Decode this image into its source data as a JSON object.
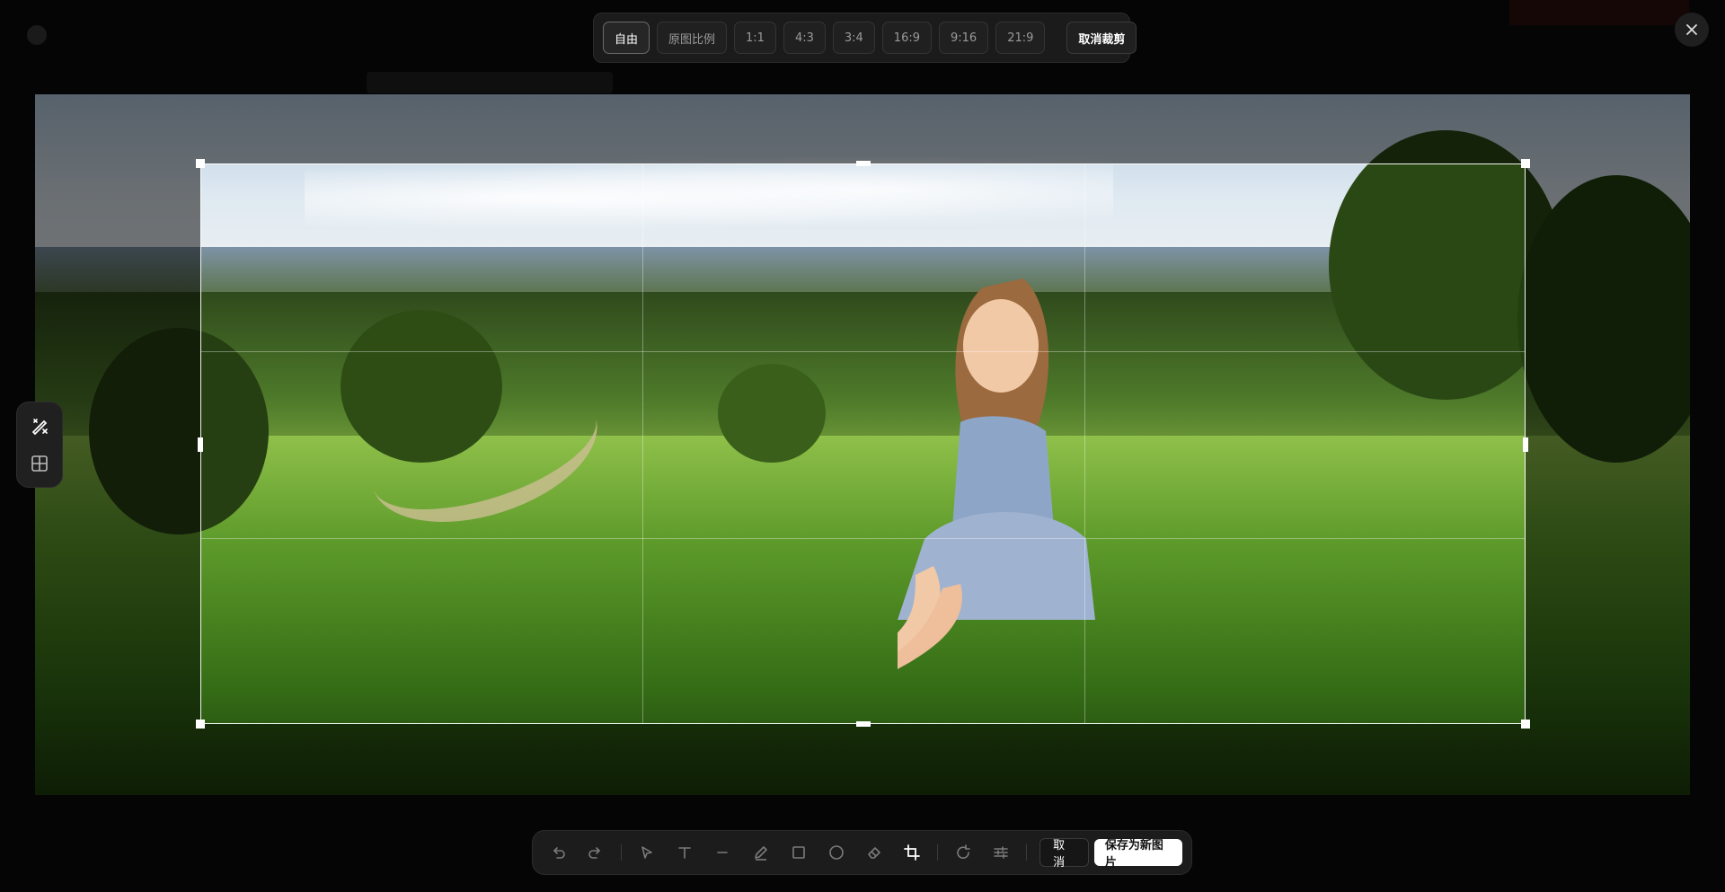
{
  "ratio_toolbar": {
    "options": [
      {
        "label": "自由",
        "active": true
      },
      {
        "label": "原图比例",
        "active": false
      },
      {
        "label": "1:1",
        "active": false
      },
      {
        "label": "4:3",
        "active": false
      },
      {
        "label": "3:4",
        "active": false
      },
      {
        "label": "16:9",
        "active": false
      },
      {
        "label": "9:16",
        "active": false
      },
      {
        "label": "21:9",
        "active": false
      }
    ],
    "cancel_crop_label": "取消裁剪"
  },
  "close_icon": "close-icon",
  "side_tools": [
    "magic-pencil-icon",
    "grid-icon"
  ],
  "bottom_toolbar": {
    "tools": [
      "undo-icon",
      "redo-icon",
      "select-arrow-icon",
      "text-icon",
      "line-icon",
      "pen-icon",
      "rectangle-icon",
      "circle-icon",
      "eraser-icon",
      "crop-icon",
      "rotate-icon",
      "adjust-sliders-icon"
    ],
    "active_tool": "crop-icon",
    "cancel_label": "取消",
    "save_label": "保存为新图片"
  },
  "colors": {
    "background": "#050505",
    "toolbar": "#1c1c1c",
    "accent": "#ffffff"
  }
}
